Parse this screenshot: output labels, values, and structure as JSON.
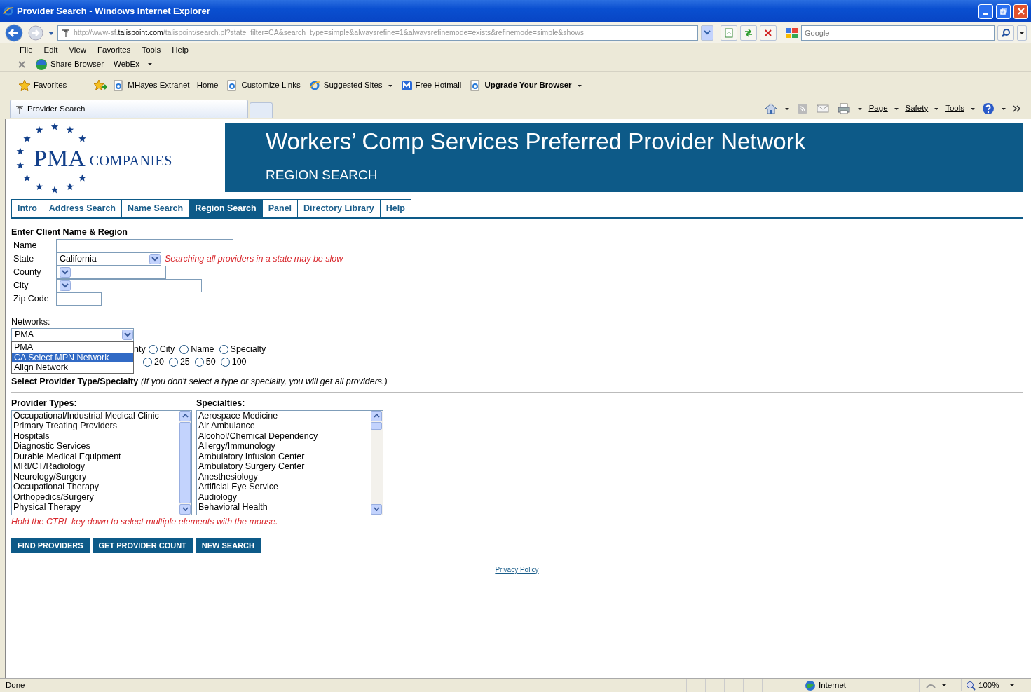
{
  "window": {
    "title": "Provider Search - Windows Internet Explorer"
  },
  "address_bar": {
    "url_start": "http://www-sf.",
    "url_host": "talispoint.com",
    "url_path": "/talispoint/search.pl?state_filter=CA&search_type=simple&alwaysrefine=1&alwaysrefinemode=exists&refinemode=simple&shows"
  },
  "search_box": {
    "placeholder": "Google"
  },
  "menu_bar": [
    "File",
    "Edit",
    "View",
    "Favorites",
    "Tools",
    "Help"
  ],
  "links_bar": [
    {
      "label": "Share Browser",
      "kind": "globe"
    },
    {
      "label": "WebEx",
      "kind": "menu"
    }
  ],
  "favorites_bar": {
    "label": "Favorites",
    "links": [
      {
        "label": "MHayes Extranet - Home",
        "kind": "page"
      },
      {
        "label": "Customize Links",
        "kind": "page"
      },
      {
        "label": "Suggested Sites",
        "kind": "ie",
        "menu": true
      },
      {
        "label": "Free Hotmail",
        "kind": "hotmail"
      },
      {
        "label": "Upgrade Your Browser",
        "kind": "page",
        "bold": true,
        "menu": true
      }
    ]
  },
  "browser_tab": {
    "title": "Provider Search"
  },
  "command_bar": [
    "Page",
    "Safety",
    "Tools"
  ],
  "logo": {
    "name": "PMA",
    "suffix": "COMPANIES"
  },
  "banner": {
    "title": "Workers’ Comp Services Preferred Provider Network",
    "subtitle": "REGION SEARCH"
  },
  "nav_tabs": [
    {
      "label": "Intro",
      "selected": false
    },
    {
      "label": "Address Search",
      "selected": false
    },
    {
      "label": "Name Search",
      "selected": false
    },
    {
      "label": "Region Search",
      "selected": true
    },
    {
      "label": "Panel",
      "selected": false
    },
    {
      "label": "Directory Library",
      "selected": false
    },
    {
      "label": "Help",
      "selected": false
    }
  ],
  "form": {
    "heading": "Enter Client Name & Region",
    "fields": [
      {
        "label": "Name",
        "kind": "text"
      },
      {
        "label": "State",
        "kind": "select",
        "value": "California",
        "warning": "Searching all providers in a state may be slow"
      },
      {
        "label": "County",
        "kind": "select"
      },
      {
        "label": "City",
        "kind": "select"
      },
      {
        "label": "Zip Code",
        "kind": "text"
      }
    ]
  },
  "networks": {
    "label": "Networks:",
    "value": "PMA",
    "expanded": true,
    "options": [
      {
        "label": "PMA",
        "highlighted": false
      },
      {
        "label": "CA Select MPN Network",
        "highlighted": true
      },
      {
        "label": "Align Network",
        "highlighted": false
      }
    ]
  },
  "radio_groups": [
    {
      "partial_label": "nty",
      "options": [
        {
          "label": "City",
          "selected": false
        },
        {
          "label": "Name",
          "selected": false
        },
        {
          "label": "Specialty",
          "selected": false
        }
      ]
    },
    {
      "options": [
        {
          "label": "20",
          "selected": false
        },
        {
          "label": "25",
          "selected": false
        },
        {
          "label": "50",
          "selected": false
        },
        {
          "label": "100",
          "selected": false
        }
      ]
    }
  ],
  "type_section": {
    "title": "Select Provider Type/Specialty",
    "note": "(If you don't select a type or specialty, you will get all providers.)"
  },
  "lists": [
    {
      "label": "Provider Types:",
      "items": [
        "Occupational/Industrial Medical Clinic",
        "Primary Treating Providers",
        "Hospitals",
        "Diagnostic Services",
        "Durable Medical Equipment",
        "MRI/CT/Radiology",
        "Neurology/Surgery",
        "Occupational Therapy",
        "Orthopedics/Surgery",
        "Physical Therapy"
      ]
    },
    {
      "label": "Specialties:",
      "items": [
        "Aerospace Medicine",
        "Air Ambulance",
        "Alcohol/Chemical Dependency",
        "Allergy/Immunology",
        "Ambulatory Infusion Center",
        "Ambulatory Surgery Center",
        "Anesthesiology",
        "Artificial Eye Service",
        "Audiology",
        "Behavioral Health"
      ]
    }
  ],
  "hint": "Hold the CTRL key down to select multiple elements with the mouse.",
  "buttons": [
    "FIND PROVIDERS",
    "GET PROVIDER COUNT",
    "NEW SEARCH"
  ],
  "privacy_link": "Privacy Policy",
  "status_bar": {
    "text": "Done",
    "zone": "Internet",
    "zoom": "100%"
  }
}
